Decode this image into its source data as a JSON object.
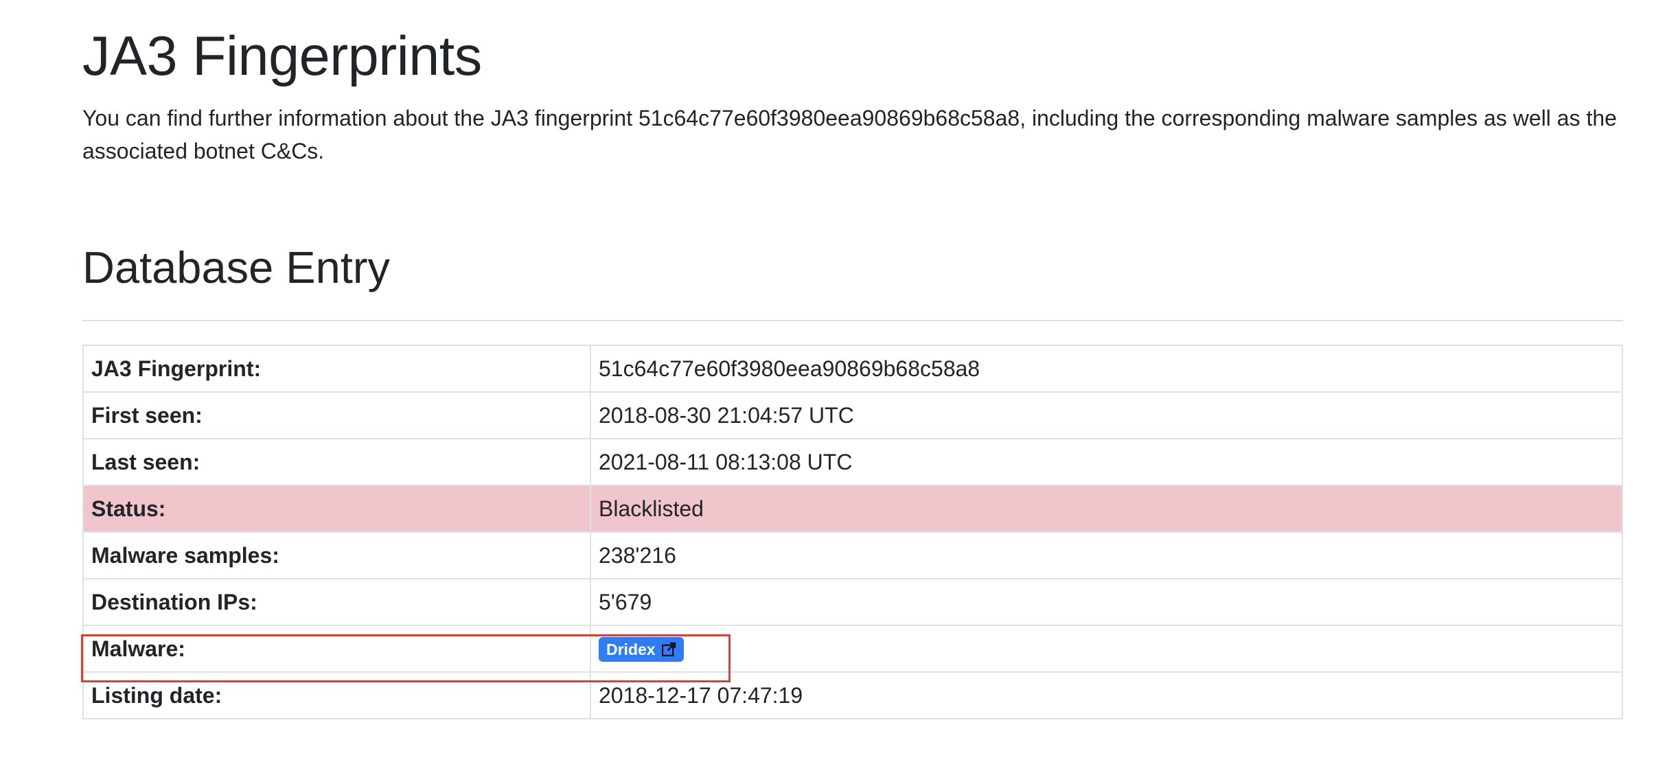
{
  "header": {
    "title": "JA3 Fingerprints",
    "intro": "You can find further information about the JA3 fingerprint 51c64c77e60f3980eea90869b68c58a8, including the corresponding malware samples as well as the associated botnet C&Cs."
  },
  "section": {
    "title": "Database Entry"
  },
  "table": {
    "rows": [
      {
        "label": "JA3 Fingerprint:",
        "value": "51c64c77e60f3980eea90869b68c58a8"
      },
      {
        "label": "First seen:",
        "value": "2018-08-30 21:04:57 UTC"
      },
      {
        "label": "Last seen:",
        "value": "2021-08-11 08:13:08 UTC"
      },
      {
        "label": "Status:",
        "value": "Blacklisted"
      },
      {
        "label": "Malware samples:",
        "value": "238'216"
      },
      {
        "label": "Destination IPs:",
        "value": "5'679"
      },
      {
        "label": "Malware:",
        "value": "Dridex"
      },
      {
        "label": "Listing date:",
        "value": "2018-12-17 07:47:19"
      }
    ]
  },
  "colors": {
    "text": "#212529",
    "border": "#dee2e6",
    "status_row_bg": "#f0c6cc",
    "badge_bg": "#2f7df6",
    "highlight_outline": "#d9412f"
  },
  "icons": {
    "badge_icon": "external-link-icon"
  }
}
